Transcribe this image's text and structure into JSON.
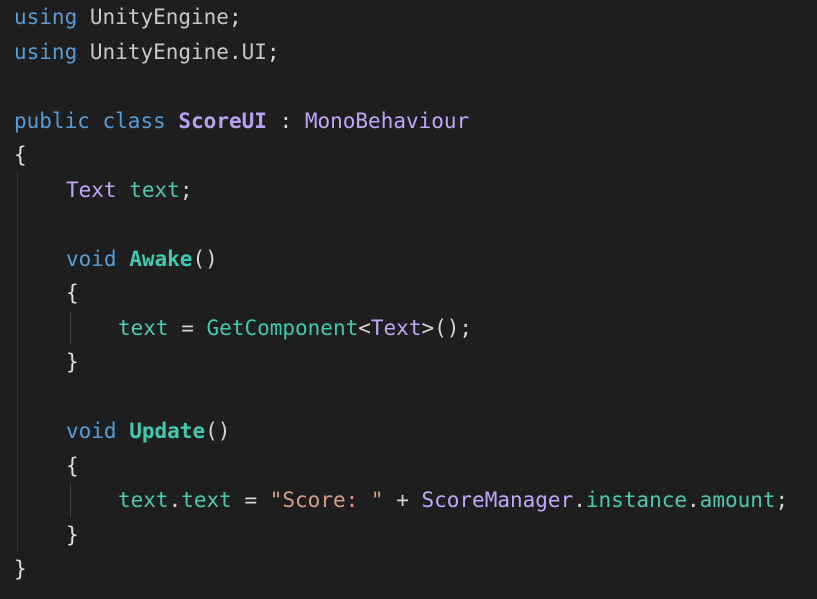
{
  "colors": {
    "background": "#1e1e1e",
    "keyword": "#569cd6",
    "namespace": "#c8c8c8",
    "class_decl": "#b8a0f0",
    "type": "#c1a6f7",
    "method": "#3fc9b0",
    "field": "#4ec9b0",
    "string": "#d69d85",
    "punct": "#d4d4d4",
    "brace": "#e0e0e0"
  },
  "lines": [
    {
      "indent": 0,
      "tokens": [
        {
          "t": "using",
          "c": "keyword"
        },
        {
          "t": " ",
          "c": "punct"
        },
        {
          "t": "UnityEngine",
          "c": "namespace"
        },
        {
          "t": ";",
          "c": "punct"
        }
      ]
    },
    {
      "indent": 0,
      "tokens": [
        {
          "t": "using",
          "c": "keyword"
        },
        {
          "t": " ",
          "c": "punct"
        },
        {
          "t": "UnityEngine",
          "c": "namespace"
        },
        {
          "t": ".",
          "c": "punct"
        },
        {
          "t": "UI",
          "c": "namespace"
        },
        {
          "t": ";",
          "c": "punct"
        }
      ]
    },
    {
      "indent": 0,
      "tokens": []
    },
    {
      "indent": 0,
      "tokens": [
        {
          "t": "public",
          "c": "keyword"
        },
        {
          "t": " ",
          "c": "punct"
        },
        {
          "t": "class",
          "c": "keyword"
        },
        {
          "t": " ",
          "c": "punct"
        },
        {
          "t": "ScoreUI",
          "c": "class_decl",
          "bold": true
        },
        {
          "t": " : ",
          "c": "punct"
        },
        {
          "t": "MonoBehaviour",
          "c": "type"
        }
      ]
    },
    {
      "indent": 0,
      "tokens": [
        {
          "t": "{",
          "c": "brace"
        }
      ]
    },
    {
      "indent": 1,
      "tokens": [
        {
          "t": "Text",
          "c": "type"
        },
        {
          "t": " ",
          "c": "punct"
        },
        {
          "t": "text",
          "c": "field"
        },
        {
          "t": ";",
          "c": "punct"
        }
      ]
    },
    {
      "indent": 0,
      "tokens": []
    },
    {
      "indent": 1,
      "tokens": [
        {
          "t": "void",
          "c": "keyword"
        },
        {
          "t": " ",
          "c": "punct"
        },
        {
          "t": "Awake",
          "c": "method",
          "bold": true
        },
        {
          "t": "()",
          "c": "punct"
        }
      ]
    },
    {
      "indent": 1,
      "tokens": [
        {
          "t": "{",
          "c": "brace"
        }
      ]
    },
    {
      "indent": 2,
      "tokens": [
        {
          "t": "text",
          "c": "field"
        },
        {
          "t": " = ",
          "c": "punct"
        },
        {
          "t": "GetComponent",
          "c": "method"
        },
        {
          "t": "<",
          "c": "punct"
        },
        {
          "t": "Text",
          "c": "type"
        },
        {
          "t": ">();",
          "c": "punct"
        }
      ]
    },
    {
      "indent": 1,
      "tokens": [
        {
          "t": "}",
          "c": "brace"
        }
      ]
    },
    {
      "indent": 0,
      "tokens": []
    },
    {
      "indent": 1,
      "tokens": [
        {
          "t": "void",
          "c": "keyword"
        },
        {
          "t": " ",
          "c": "punct"
        },
        {
          "t": "Update",
          "c": "method",
          "bold": true
        },
        {
          "t": "()",
          "c": "punct"
        }
      ]
    },
    {
      "indent": 1,
      "tokens": [
        {
          "t": "{",
          "c": "brace"
        }
      ]
    },
    {
      "indent": 2,
      "tokens": [
        {
          "t": "text",
          "c": "field"
        },
        {
          "t": ".",
          "c": "punct"
        },
        {
          "t": "text",
          "c": "field"
        },
        {
          "t": " = ",
          "c": "punct"
        },
        {
          "t": "\"Score: \"",
          "c": "string"
        },
        {
          "t": " + ",
          "c": "punct"
        },
        {
          "t": "ScoreManager",
          "c": "type"
        },
        {
          "t": ".",
          "c": "punct"
        },
        {
          "t": "instance",
          "c": "field"
        },
        {
          "t": ".",
          "c": "punct"
        },
        {
          "t": "amount",
          "c": "field"
        },
        {
          "t": ";",
          "c": "punct"
        }
      ]
    },
    {
      "indent": 1,
      "tokens": [
        {
          "t": "}",
          "c": "brace"
        }
      ]
    },
    {
      "indent": 0,
      "tokens": [
        {
          "t": "}",
          "c": "brace"
        }
      ]
    }
  ]
}
